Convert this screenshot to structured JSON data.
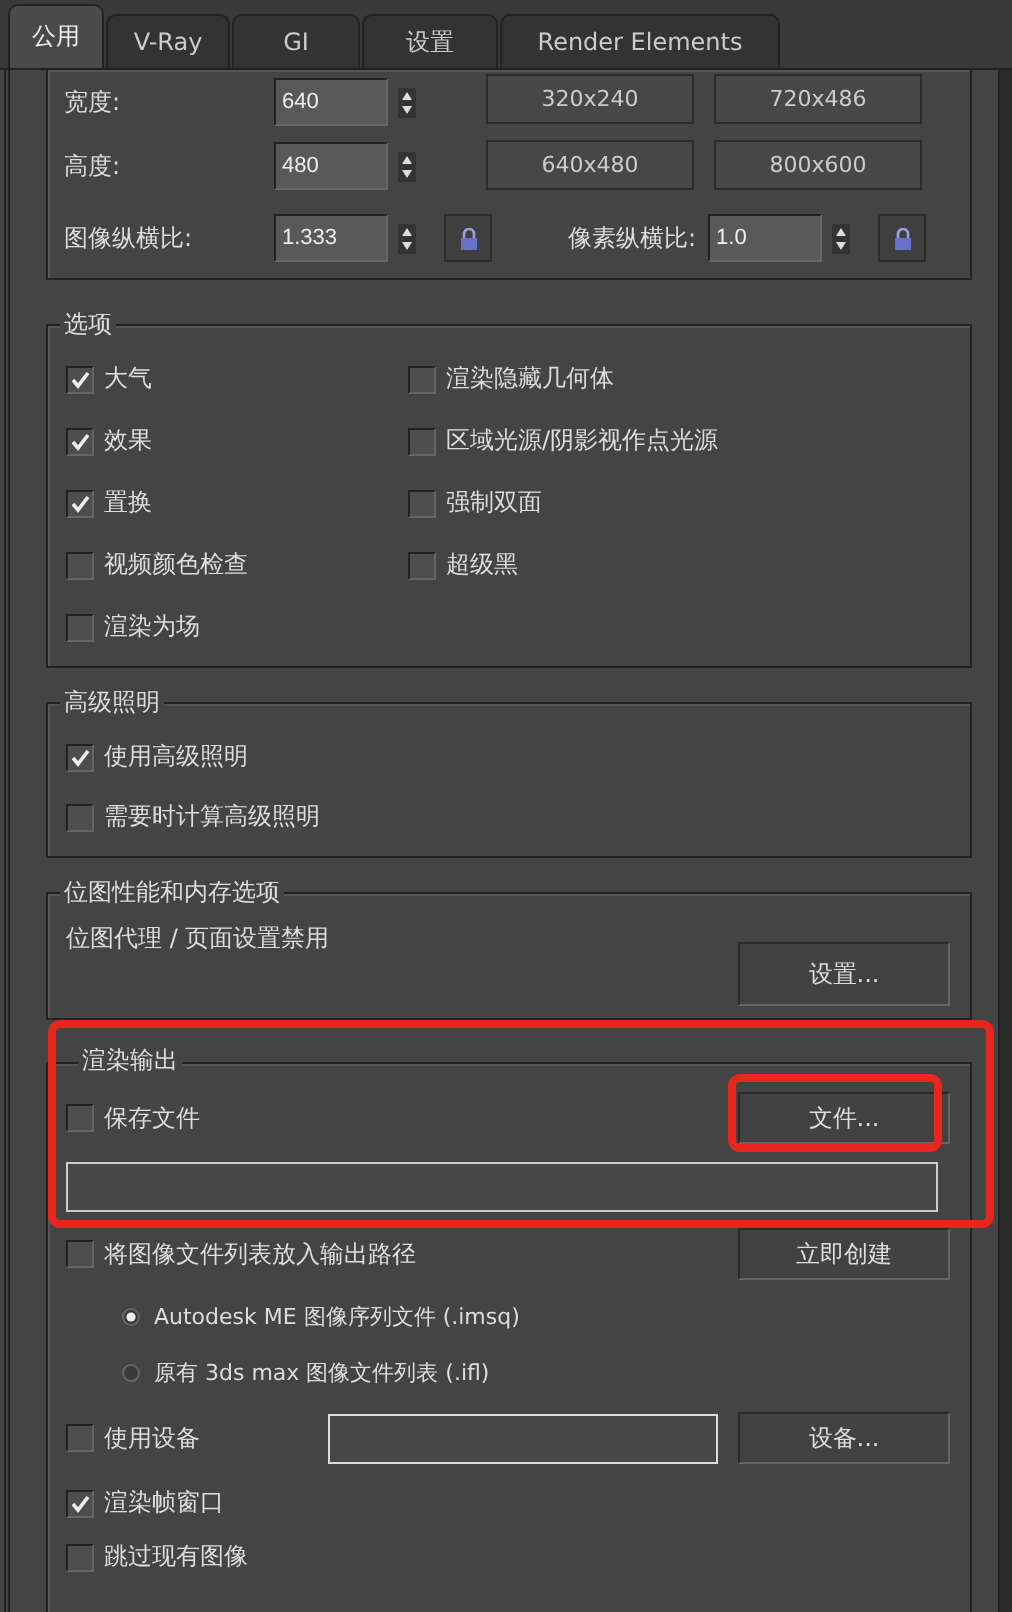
{
  "tabs": [
    {
      "label": "公用",
      "selected": true
    },
    {
      "label": "V-Ray",
      "selected": false
    },
    {
      "label": "GI",
      "selected": false
    },
    {
      "label": "设置",
      "selected": false
    },
    {
      "label": "Render Elements",
      "selected": false
    }
  ],
  "output_size": {
    "width": {
      "label": "宽度:",
      "value": "640"
    },
    "height": {
      "label": "高度:",
      "value": "480"
    },
    "presets": [
      "320x240",
      "720x486",
      "640x480",
      "800x600"
    ],
    "image_aspect": {
      "label": "图像纵横比:",
      "value": "1.333"
    },
    "pixel_aspect": {
      "label": "像素纵横比:",
      "value": "1.0"
    }
  },
  "options": {
    "title": "选项",
    "items": [
      {
        "label": "大气",
        "checked": true
      },
      {
        "label": "渲染隐藏几何体",
        "checked": false
      },
      {
        "label": "效果",
        "checked": true
      },
      {
        "label": "区域光源/阴影视作点光源",
        "checked": false
      },
      {
        "label": "置换",
        "checked": true
      },
      {
        "label": "强制双面",
        "checked": false
      },
      {
        "label": "视频颜色检查",
        "checked": false
      },
      {
        "label": "超级黑",
        "checked": false
      },
      {
        "label": "渲染为场",
        "checked": false
      }
    ]
  },
  "advanced_lighting": {
    "title": "高级照明",
    "items": [
      {
        "label": "使用高级照明",
        "checked": true
      },
      {
        "label": "需要时计算高级照明",
        "checked": false
      }
    ]
  },
  "bitmap": {
    "title": "位图性能和内存选项",
    "text": "位图代理 / 页面设置禁用",
    "button": "设置..."
  },
  "render_output": {
    "title": "渲染输出",
    "highlighted": true,
    "save_file": {
      "label": "保存文件",
      "checked": false
    },
    "file_button": {
      "label": "文件...",
      "highlighted": true
    },
    "put_list": {
      "label": "将图像文件列表放入输出路径",
      "checked": false
    },
    "create_button": "立即创建",
    "list_formats": [
      {
        "label": "Autodesk ME 图像序列文件 (.imsq)",
        "selected": true
      },
      {
        "label": "原有 3ds max 图像文件列表 (.ifl)",
        "selected": false
      }
    ],
    "use_device": {
      "label": "使用设备",
      "checked": false
    },
    "device_button": "设备...",
    "frame_window": {
      "label": "渲染帧窗口",
      "checked": true
    },
    "skip_existing": {
      "label": "跳过现有图像",
      "checked": false
    }
  }
}
